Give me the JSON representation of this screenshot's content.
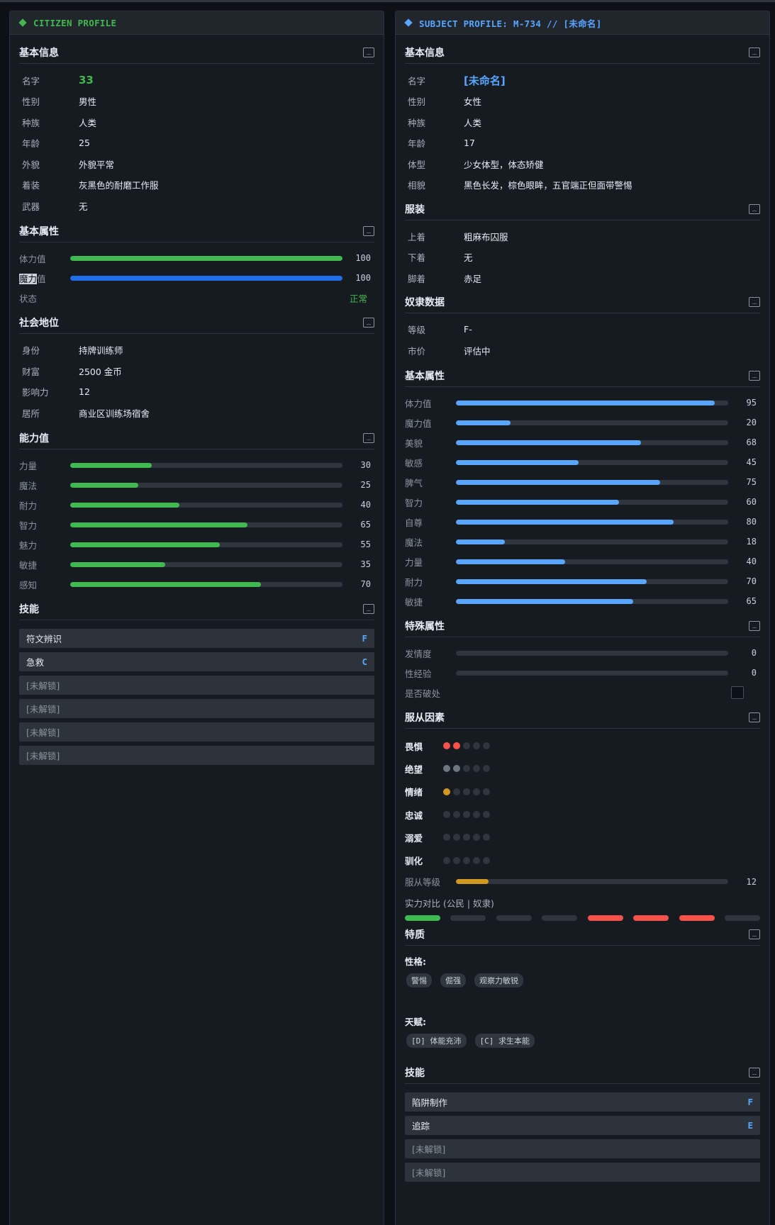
{
  "left": {
    "header": "CITIZEN PROFILE",
    "basic": {
      "title": "基本信息",
      "collapse": "_",
      "name_label": "名字",
      "name": "33",
      "rows": [
        {
          "k": "性别",
          "v": "男性"
        },
        {
          "k": "种族",
          "v": "人类"
        },
        {
          "k": "年龄",
          "v": "25"
        },
        {
          "k": "外貌",
          "v": "外貌平常"
        },
        {
          "k": "着装",
          "v": "灰黑色的耐磨工作服"
        },
        {
          "k": "武器",
          "v": "无"
        }
      ]
    },
    "attrs": {
      "title": "基本属性",
      "collapse": "_",
      "hp_label": "体力值",
      "hp_value": 100,
      "hp_max": 100,
      "mp_label_hl": "魔力",
      "mp_label_rest": "值",
      "mp_value": 100,
      "mp_max": 100,
      "status_label": "状态",
      "status_value": "正常"
    },
    "social": {
      "title": "社会地位",
      "collapse": "_",
      "rows": [
        {
          "k": "身份",
          "v": "持牌训练师"
        },
        {
          "k": "财富",
          "v": "2500 金币"
        },
        {
          "k": "影响力",
          "v": "12"
        },
        {
          "k": "居所",
          "v": "商业区训练场宿舍"
        }
      ]
    },
    "abilities": {
      "title": "能力值",
      "collapse": "_",
      "items": [
        {
          "k": "力量",
          "v": 30
        },
        {
          "k": "魔法",
          "v": 25
        },
        {
          "k": "耐力",
          "v": 40
        },
        {
          "k": "智力",
          "v": 65
        },
        {
          "k": "魅力",
          "v": 55
        },
        {
          "k": "敏捷",
          "v": 35
        },
        {
          "k": "感知",
          "v": 70
        }
      ]
    },
    "skills": {
      "title": "技能",
      "collapse": "_",
      "items": [
        {
          "name": "符文辨识",
          "grade": "F"
        },
        {
          "name": "急救",
          "grade": "C"
        },
        {
          "name": "[未解锁]",
          "grade": ""
        },
        {
          "name": "[未解锁]",
          "grade": ""
        },
        {
          "name": "[未解锁]",
          "grade": ""
        },
        {
          "name": "[未解锁]",
          "grade": ""
        }
      ]
    }
  },
  "right": {
    "header": "SUBJECT PROFILE: M-734 // [未命名]",
    "basic": {
      "title": "基本信息",
      "collapse": "_",
      "name_label": "名字",
      "name": "[未命名]",
      "rows": [
        {
          "k": "性别",
          "v": "女性"
        },
        {
          "k": "种族",
          "v": "人类"
        },
        {
          "k": "年龄",
          "v": "17"
        },
        {
          "k": "体型",
          "v": "少女体型，体态矫健"
        },
        {
          "k": "相貌",
          "v": "黑色长发，棕色眼眸，五官端正但面带警惕"
        }
      ]
    },
    "clothing": {
      "title": "服装",
      "collapse": "_",
      "rows": [
        {
          "k": "上着",
          "v": "粗麻布囚服"
        },
        {
          "k": "下着",
          "v": "无"
        },
        {
          "k": "脚着",
          "v": "赤足"
        }
      ]
    },
    "slave": {
      "title": "奴隶数据",
      "collapse": "_",
      "rows": [
        {
          "k": "等级",
          "v": "F-"
        },
        {
          "k": "市价",
          "v": "评估中"
        }
      ]
    },
    "attrs": {
      "title": "基本属性",
      "collapse": "_",
      "items": [
        {
          "k": "体力值",
          "v": 95
        },
        {
          "k": "魔力值",
          "v": 20
        },
        {
          "k": "美貌",
          "v": 68
        },
        {
          "k": "敏感",
          "v": 45
        },
        {
          "k": "脾气",
          "v": 75
        },
        {
          "k": "智力",
          "v": 60
        },
        {
          "k": "自尊",
          "v": 80
        },
        {
          "k": "魔法",
          "v": 18
        },
        {
          "k": "力量",
          "v": 40
        },
        {
          "k": "耐力",
          "v": 70
        },
        {
          "k": "敏捷",
          "v": 65
        }
      ]
    },
    "special": {
      "title": "特殊属性",
      "collapse": "_",
      "items": [
        {
          "k": "发情度",
          "v": 0
        },
        {
          "k": "性经验",
          "v": 0
        }
      ],
      "virgin_label": "是否破处"
    },
    "obedience": {
      "title": "服从因素",
      "collapse": "_",
      "factors": [
        {
          "k": "畏惧",
          "filled": 2,
          "color": "#f85149"
        },
        {
          "k": "绝望",
          "filled": 2,
          "color": "#6e7681"
        },
        {
          "k": "情绪",
          "filled": 1,
          "color": "#d29922"
        },
        {
          "k": "忠诚",
          "filled": 0,
          "color": "#30363d"
        },
        {
          "k": "溺爱",
          "filled": 0,
          "color": "#30363d"
        },
        {
          "k": "驯化",
          "filled": 0,
          "color": "#30363d"
        }
      ],
      "level_label": "服从等级",
      "level_value": 12,
      "compare_label": "实力对比 (公民 | 奴隶)",
      "compare": [
        "green",
        "gray",
        "gray",
        "gray",
        "red",
        "red",
        "red",
        "gray"
      ]
    },
    "traits": {
      "title": "特质",
      "collapse": "_",
      "personality_label": "性格:",
      "personality": [
        "警惕",
        "倔强",
        "观察力敏锐"
      ],
      "talent_label": "天赋:",
      "talents": [
        "[D] 体能充沛",
        "[C] 求生本能"
      ]
    },
    "skills": {
      "title": "技能",
      "collapse": "_",
      "items": [
        {
          "name": "陷阱制作",
          "grade": "F"
        },
        {
          "name": "追踪",
          "grade": "E"
        },
        {
          "name": "[未解锁]",
          "grade": ""
        },
        {
          "name": "[未解锁]",
          "grade": ""
        }
      ]
    }
  },
  "colors": {
    "green": "#3fb950",
    "blue_mp": "#1f6feb",
    "blue": "#58a6ff",
    "gold": "#d29922",
    "red": "#f85149",
    "gray": "#30363d"
  }
}
